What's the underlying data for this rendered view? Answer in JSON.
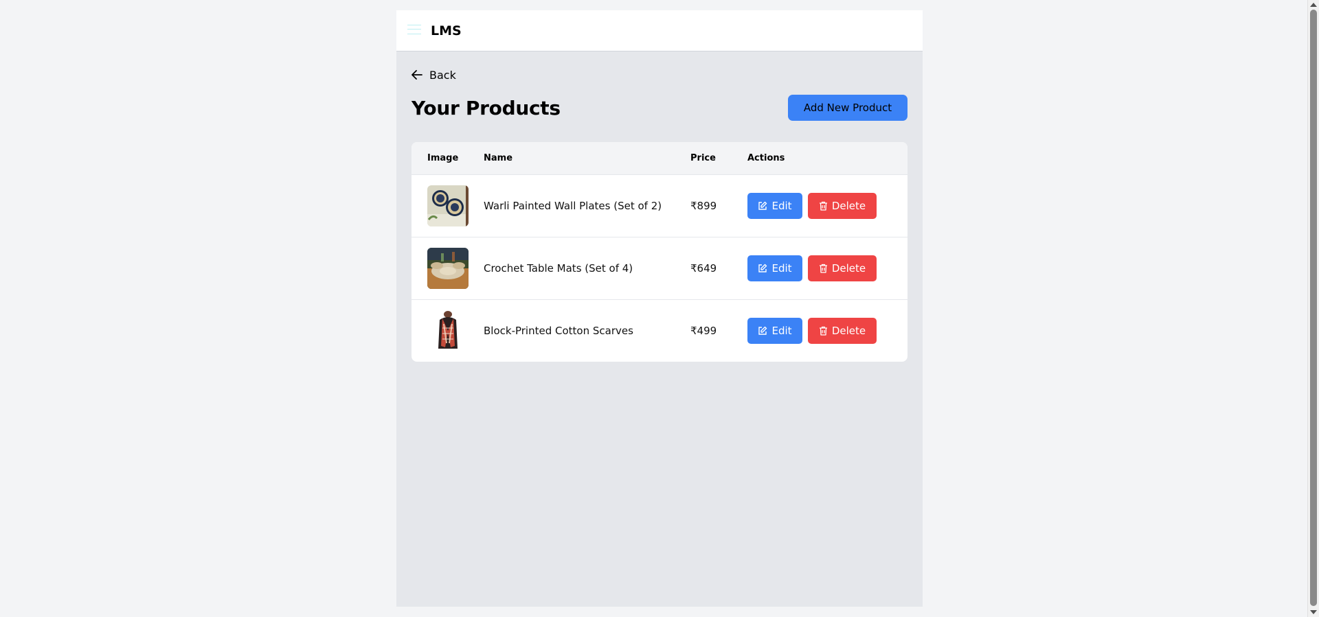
{
  "header": {
    "brand": "LMS"
  },
  "nav": {
    "back_label": "Back"
  },
  "page": {
    "title": "Your Products",
    "add_button_label": "Add New Product"
  },
  "table": {
    "columns": [
      "Image",
      "Name",
      "Price",
      "Actions"
    ],
    "rows": [
      {
        "name": "Warli Painted Wall Plates (Set of 2)",
        "price": "₹899",
        "edit_label": "Edit",
        "delete_label": "Delete"
      },
      {
        "name": "Crochet Table Mats (Set of 4)",
        "price": "₹649",
        "edit_label": "Edit",
        "delete_label": "Delete"
      },
      {
        "name": "Block-Printed Cotton Scarves",
        "price": "₹499",
        "edit_label": "Edit",
        "delete_label": "Delete"
      }
    ]
  },
  "colors": {
    "primary": "#3b82f6",
    "danger": "#ef4444",
    "page_bg": "#e5e7eb"
  },
  "icons": {
    "menu": "hamburger-icon",
    "back": "arrow-left-icon",
    "edit": "edit-icon",
    "delete": "trash-icon"
  }
}
